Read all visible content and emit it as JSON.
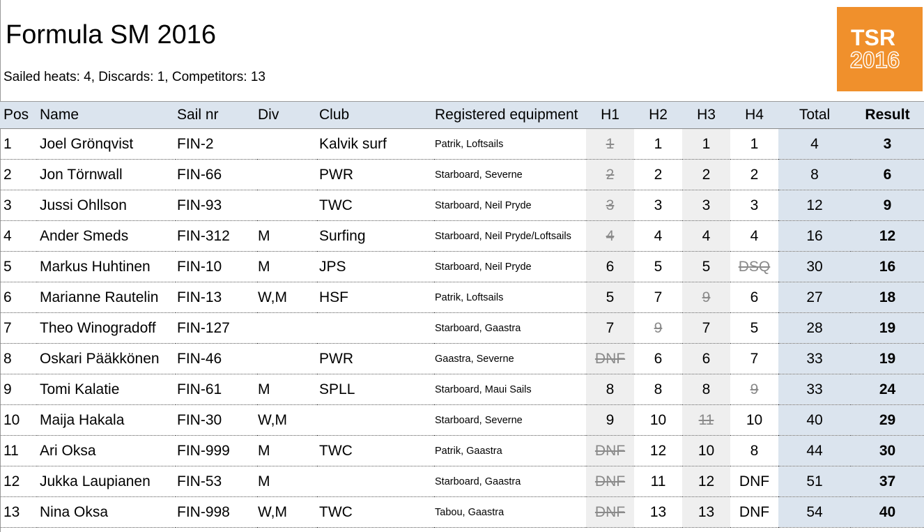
{
  "header": {
    "title": "Formula SM 2016",
    "summary": "Sailed heats: 4, Discards: 1, Competitors: 13"
  },
  "logo": {
    "line1": "TSR",
    "line2": "2016",
    "color": "#f0902c"
  },
  "table": {
    "columns": [
      "Pos",
      "Name",
      "Sail nr",
      "Div",
      "Club",
      "Registered equipment",
      "H1",
      "H2",
      "H3",
      "H4",
      "Total",
      "Result"
    ],
    "rows": [
      {
        "pos": "1",
        "name": "Joel Grönqvist",
        "sail": "FIN-2",
        "div": "",
        "club": "Kalvik surf",
        "equipment": "Patrik, Loftsails",
        "heats": [
          {
            "v": "1",
            "discard": true
          },
          {
            "v": "1",
            "discard": false
          },
          {
            "v": "1",
            "discard": false
          },
          {
            "v": "1",
            "discard": false
          }
        ],
        "total": "4",
        "result": "3"
      },
      {
        "pos": "2",
        "name": "Jon Törnwall",
        "sail": "FIN-66",
        "div": "",
        "club": "PWR",
        "equipment": "Starboard, Severne",
        "heats": [
          {
            "v": "2",
            "discard": true
          },
          {
            "v": "2",
            "discard": false
          },
          {
            "v": "2",
            "discard": false
          },
          {
            "v": "2",
            "discard": false
          }
        ],
        "total": "8",
        "result": "6"
      },
      {
        "pos": "3",
        "name": "Jussi Ohllson",
        "sail": "FIN-93",
        "div": "",
        "club": "TWC",
        "equipment": "Starboard, Neil Pryde",
        "heats": [
          {
            "v": "3",
            "discard": true
          },
          {
            "v": "3",
            "discard": false
          },
          {
            "v": "3",
            "discard": false
          },
          {
            "v": "3",
            "discard": false
          }
        ],
        "total": "12",
        "result": "9"
      },
      {
        "pos": "4",
        "name": "Ander Smeds",
        "sail": "FIN-312",
        "div": "M",
        "club": "Surfing",
        "equipment": "Starboard, Neil Pryde/Loftsails",
        "heats": [
          {
            "v": "4",
            "discard": true
          },
          {
            "v": "4",
            "discard": false
          },
          {
            "v": "4",
            "discard": false
          },
          {
            "v": "4",
            "discard": false
          }
        ],
        "total": "16",
        "result": "12"
      },
      {
        "pos": "5",
        "name": "Markus Huhtinen",
        "sail": "FIN-10",
        "div": "M",
        "club": "JPS",
        "equipment": "Starboard, Neil Pryde",
        "heats": [
          {
            "v": "6",
            "discard": false
          },
          {
            "v": "5",
            "discard": false
          },
          {
            "v": "5",
            "discard": false
          },
          {
            "v": "DSQ",
            "discard": true
          }
        ],
        "total": "30",
        "result": "16"
      },
      {
        "pos": "6",
        "name": "Marianne Rautelin",
        "sail": "FIN-13",
        "div": "W,M",
        "club": "HSF",
        "equipment": "Patrik, Loftsails",
        "heats": [
          {
            "v": "5",
            "discard": false
          },
          {
            "v": "7",
            "discard": false
          },
          {
            "v": "9",
            "discard": true
          },
          {
            "v": "6",
            "discard": false
          }
        ],
        "total": "27",
        "result": "18"
      },
      {
        "pos": "7",
        "name": "Theo Winogradoff",
        "sail": "FIN-127",
        "div": "",
        "club": "",
        "equipment": "Starboard, Gaastra",
        "heats": [
          {
            "v": "7",
            "discard": false
          },
          {
            "v": "9",
            "discard": true
          },
          {
            "v": "7",
            "discard": false
          },
          {
            "v": "5",
            "discard": false
          }
        ],
        "total": "28",
        "result": "19"
      },
      {
        "pos": "8",
        "name": "Oskari Pääkkönen",
        "sail": "FIN-46",
        "div": "",
        "club": "PWR",
        "equipment": "Gaastra, Severne",
        "heats": [
          {
            "v": "DNF",
            "discard": true
          },
          {
            "v": "6",
            "discard": false
          },
          {
            "v": "6",
            "discard": false
          },
          {
            "v": "7",
            "discard": false
          }
        ],
        "total": "33",
        "result": "19"
      },
      {
        "pos": "9",
        "name": "Tomi Kalatie",
        "sail": "FIN-61",
        "div": "M",
        "club": "SPLL",
        "equipment": "Starboard, Maui Sails",
        "heats": [
          {
            "v": "8",
            "discard": false
          },
          {
            "v": "8",
            "discard": false
          },
          {
            "v": "8",
            "discard": false
          },
          {
            "v": "9",
            "discard": true
          }
        ],
        "total": "33",
        "result": "24"
      },
      {
        "pos": "10",
        "name": "Maija Hakala",
        "sail": "FIN-30",
        "div": "W,M",
        "club": "",
        "equipment": "Starboard, Severne",
        "heats": [
          {
            "v": "9",
            "discard": false
          },
          {
            "v": "10",
            "discard": false
          },
          {
            "v": "11",
            "discard": true
          },
          {
            "v": "10",
            "discard": false
          }
        ],
        "total": "40",
        "result": "29"
      },
      {
        "pos": "11",
        "name": "Ari Oksa",
        "sail": "FIN-999",
        "div": "M",
        "club": "TWC",
        "equipment": "Patrik, Gaastra",
        "heats": [
          {
            "v": "DNF",
            "discard": true
          },
          {
            "v": "12",
            "discard": false
          },
          {
            "v": "10",
            "discard": false
          },
          {
            "v": "8",
            "discard": false
          }
        ],
        "total": "44",
        "result": "30"
      },
      {
        "pos": "12",
        "name": "Jukka Laupianen",
        "sail": "FIN-53",
        "div": "M",
        "club": "",
        "equipment": "Starboard, Gaastra",
        "heats": [
          {
            "v": "DNF",
            "discard": true
          },
          {
            "v": "11",
            "discard": false
          },
          {
            "v": "12",
            "discard": false
          },
          {
            "v": "DNF",
            "discard": false
          }
        ],
        "total": "51",
        "result": "37"
      },
      {
        "pos": "13",
        "name": "Nina Oksa",
        "sail": "FIN-998",
        "div": "W,M",
        "club": "TWC",
        "equipment": "Tabou, Gaastra",
        "heats": [
          {
            "v": "DNF",
            "discard": true
          },
          {
            "v": "13",
            "discard": false
          },
          {
            "v": "13",
            "discard": false
          },
          {
            "v": "DNF",
            "discard": false
          }
        ],
        "total": "54",
        "result": "40"
      }
    ]
  },
  "colors": {
    "header_bg": "#dbe4ee",
    "shaded_heat_bg": "#efefef",
    "result_bg": "#dbe4ee",
    "discard_text": "#8a8a8a"
  }
}
